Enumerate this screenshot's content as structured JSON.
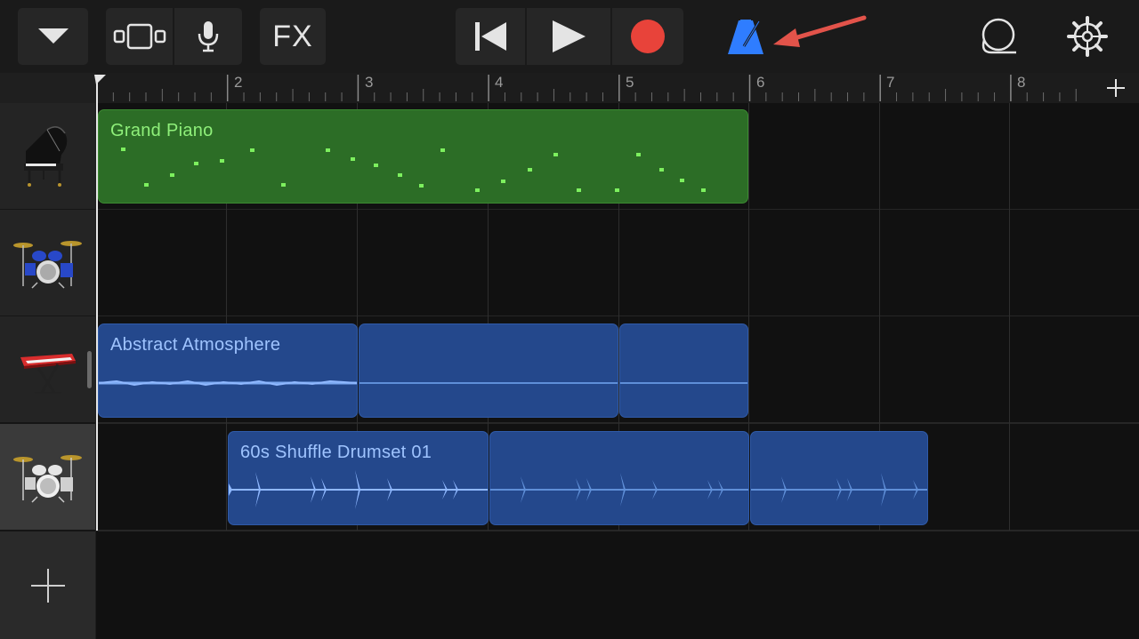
{
  "toolbar": {
    "fx_label": "FX",
    "accent_red": "#e8433a",
    "metronome_color": "#2f7dff"
  },
  "ruler": {
    "bars": [
      "2",
      "3",
      "4",
      "5",
      "6",
      "7",
      "8"
    ]
  },
  "tracks": [
    {
      "instrument": "grand-piano",
      "region_label": "Grand Piano"
    },
    {
      "instrument": "drum-kit-blue",
      "region_label": ""
    },
    {
      "instrument": "keyboard-synth",
      "region_label": "Abstract Atmosphere"
    },
    {
      "instrument": "drum-kit-silver",
      "region_label": "60s Shuffle Drumset 01"
    }
  ],
  "colors": {
    "midi_region": "#2c6d26",
    "audio_region": "#24488c",
    "annotation_arrow": "#e2534a"
  }
}
